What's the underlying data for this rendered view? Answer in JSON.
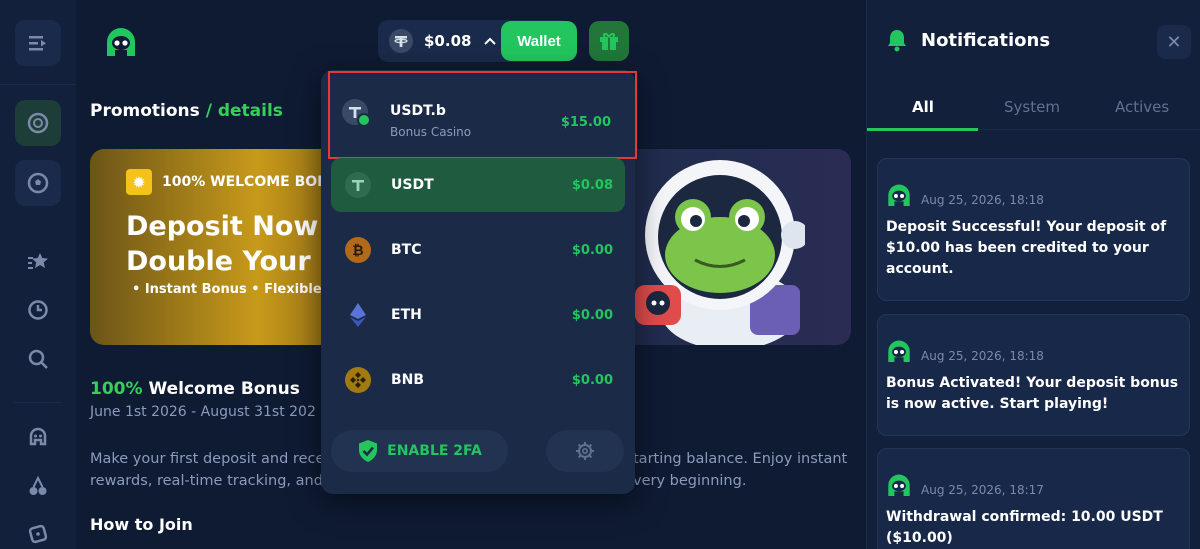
{
  "header": {
    "balance": "$0.08",
    "wallet_label": "Wallet"
  },
  "breadcrumb": {
    "root": "Promotions",
    "separator": " / ",
    "current": "details"
  },
  "banner": {
    "badge": "100%  WELCOME BON",
    "headline_1": "Deposit Now",
    "headline_2": "Double Your B",
    "bullets": "•  Instant Bonus  •  Flexible"
  },
  "promo": {
    "title_green": "100%",
    "title_rest": " Welcome Bonus",
    "dates": "June 1st 2026 - August 31st 202",
    "para_1": "Make your first deposit and rece",
    "para_1_end": "tarting balance. Enjoy instant",
    "para_2": "rewards, real-time tracking, and",
    "para_2_end": "very beginning.",
    "how_to": "How to Join"
  },
  "wallet_menu": {
    "coins": [
      {
        "name": "USDT.b",
        "sub": "Bonus Casino",
        "value": "$15.00"
      },
      {
        "name": "USDT",
        "value": "$0.08"
      },
      {
        "name": "BTC",
        "value": "$0.00"
      },
      {
        "name": "ETH",
        "value": "$0.00"
      },
      {
        "name": "BNB",
        "value": "$0.00"
      }
    ],
    "enable_2fa": "ENABLE 2FA"
  },
  "notifications": {
    "title": "Notifications",
    "tabs": [
      "All",
      "System",
      "Actives"
    ],
    "items": [
      {
        "time": "Aug 25, 2026, 18:18",
        "text": "Deposit Successful! Your deposit of $10.00 has been credited to your account."
      },
      {
        "time": "Aug 25, 2026, 18:18",
        "text": "Bonus Activated! Your deposit bonus is now active. Start playing!"
      },
      {
        "time": "Aug 25, 2026, 18:17",
        "text": "Withdrawal confirmed: 10.00 USDT ($10.00)"
      }
    ]
  },
  "colors": {
    "accent_green": "#22c55e",
    "background": "#0f1b33",
    "highlight_red": "#e53935"
  }
}
